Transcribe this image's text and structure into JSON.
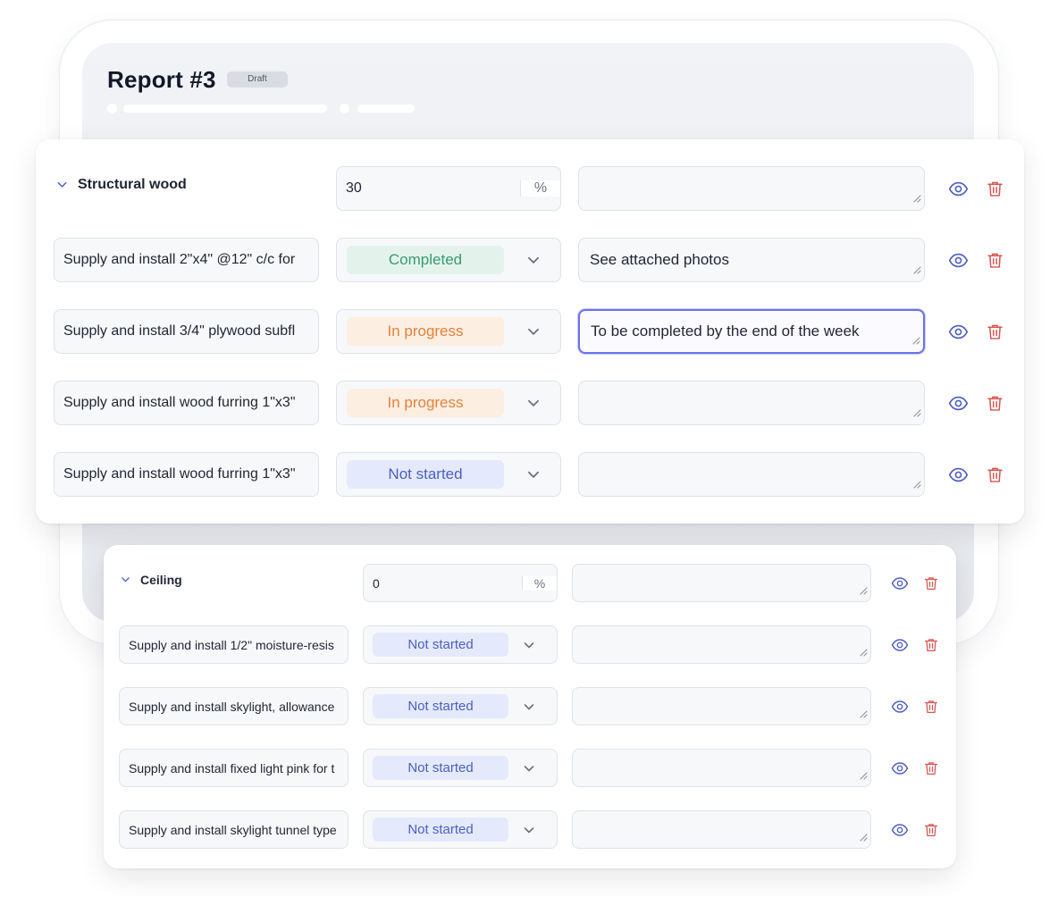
{
  "report": {
    "title": "Report #3",
    "badge": "Draft"
  },
  "colors": {
    "eye": "#4f5ec2",
    "trash": "#d9534f",
    "completed": "#3a9a6f",
    "in_progress": "#e2823b",
    "not_started": "#4c5dc4",
    "focus": "#6c72e8"
  },
  "icons": {
    "expand": "chevron-down-icon",
    "select": "chevron-down-icon",
    "view": "eye-icon",
    "delete": "trash-icon",
    "resize": "resize-grip-icon"
  },
  "sections": [
    {
      "name": "Structural wood",
      "percent": "30",
      "percent_unit": "%",
      "note": "",
      "items": [
        {
          "description": "Supply and install 2\"x4\" @12\" c/c for",
          "status": "Completed",
          "status_key": "completed",
          "note": "See attached photos"
        },
        {
          "description": "Supply and install 3/4\" plywood subfl",
          "status": "In progress",
          "status_key": "progress",
          "note": "To be completed by the end of the week"
        },
        {
          "description": "Supply and install wood furring 1\"x3\"",
          "status": "In progress",
          "status_key": "progress",
          "note": ""
        },
        {
          "description": "Supply and install wood furring 1\"x3\"",
          "status": "Not started",
          "status_key": "notstarted",
          "note": ""
        }
      ]
    },
    {
      "name": "Ceiling",
      "percent": "0",
      "percent_unit": "%",
      "note": "",
      "items": [
        {
          "description": "Supply and install 1/2\" moisture-resis",
          "status": "Not started",
          "status_key": "notstarted",
          "note": ""
        },
        {
          "description": "Supply and install skylight, allowance",
          "status": "Not started",
          "status_key": "notstarted",
          "note": ""
        },
        {
          "description": "Supply and install fixed light pink for t",
          "status": "Not started",
          "status_key": "notstarted",
          "note": ""
        },
        {
          "description": "Supply and install skylight tunnel type",
          "status": "Not started",
          "status_key": "notstarted",
          "note": ""
        }
      ]
    }
  ]
}
